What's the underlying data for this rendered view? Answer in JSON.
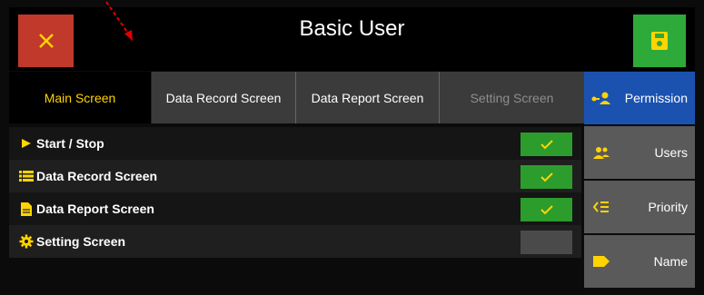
{
  "header": {
    "title": "Basic User"
  },
  "tabs": [
    {
      "label": "Main Screen",
      "active": true
    },
    {
      "label": "Data Record Screen",
      "active": false
    },
    {
      "label": "Data Report Screen",
      "active": false
    },
    {
      "label": "Setting Screen",
      "active": false,
      "disabled": true
    }
  ],
  "rows": [
    {
      "label": "Start / Stop",
      "icon": "play-icon",
      "checked": true
    },
    {
      "label": "Data Record Screen",
      "icon": "list-icon",
      "checked": true
    },
    {
      "label": "Data Report Screen",
      "icon": "document-icon",
      "checked": true
    },
    {
      "label": "Setting Screen",
      "icon": "gear-icon",
      "checked": false
    }
  ],
  "sidebar": [
    {
      "label": "Permission",
      "icon": "user-key-icon",
      "active": true
    },
    {
      "label": "Users",
      "icon": "users-icon",
      "active": false
    },
    {
      "label": "Priority",
      "icon": "priority-list-icon",
      "active": false
    },
    {
      "label": "Name",
      "icon": "tag-icon",
      "active": false
    }
  ],
  "colors": {
    "accent_yellow": "#ffd400",
    "close_red": "#c0392b",
    "save_green": "#2eaa3a",
    "check_green": "#2c9c2c",
    "active_blue": "#1b52b0"
  }
}
